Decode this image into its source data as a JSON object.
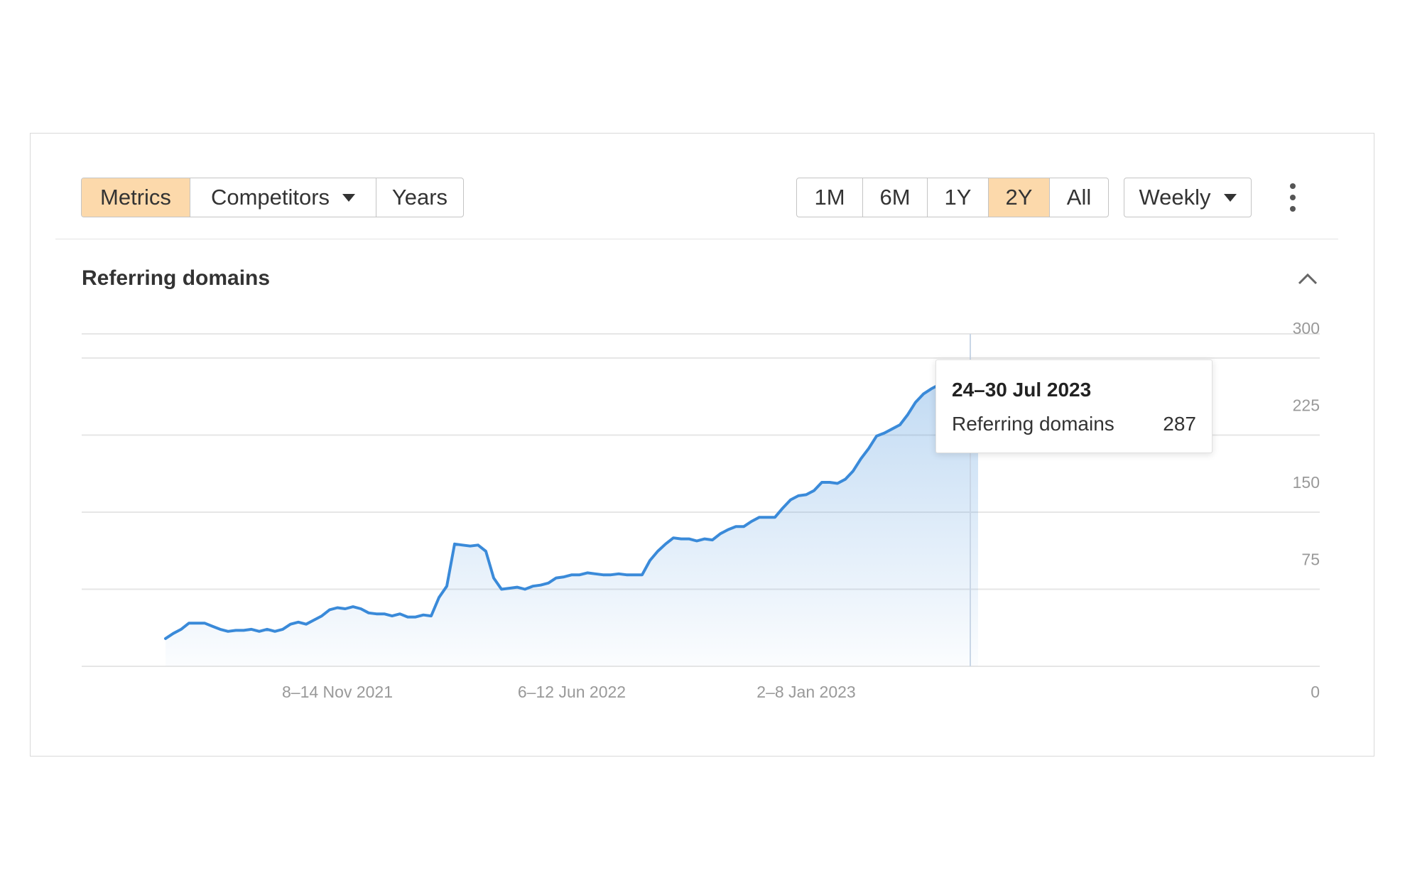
{
  "toolbar": {
    "view_tabs": [
      {
        "label": "Metrics",
        "active": true
      },
      {
        "label": "Competitors",
        "active": false,
        "dropdown": true
      },
      {
        "label": "Years",
        "active": false
      }
    ],
    "ranges": [
      {
        "label": "1M",
        "active": false
      },
      {
        "label": "6M",
        "active": false
      },
      {
        "label": "1Y",
        "active": false
      },
      {
        "label": "2Y",
        "active": true
      },
      {
        "label": "All",
        "active": false
      }
    ],
    "interval": "Weekly"
  },
  "section": {
    "title": "Referring domains"
  },
  "tooltip": {
    "date": "24–30 Jul 2023",
    "label": "Referring domains",
    "value": "287"
  },
  "colors": {
    "line": "#3a8ad9",
    "active_tab": "#fcd9ab",
    "grid": "#e6e6e6"
  },
  "chart_data": {
    "type": "area",
    "title": "Referring domains",
    "x_labels": [
      "8–14 Nov 2021",
      "6–12 Jun 2022",
      "2–8 Jan 2023"
    ],
    "x_label_weeks": [
      22,
      52,
      82
    ],
    "y_ticks": [
      0,
      75,
      150,
      225,
      300
    ],
    "ylim": [
      0,
      300
    ],
    "grid": true,
    "highlight_index": 103,
    "series": [
      {
        "name": "Referring domains",
        "values": [
          27,
          32,
          36,
          42,
          42,
          42,
          39,
          36,
          34,
          35,
          35,
          36,
          34,
          36,
          34,
          36,
          41,
          43,
          41,
          45,
          49,
          55,
          57,
          56,
          58,
          56,
          52,
          51,
          51,
          49,
          51,
          48,
          48,
          50,
          49,
          67,
          78,
          119,
          118,
          117,
          118,
          112,
          86,
          75,
          76,
          77,
          75,
          78,
          79,
          81,
          86,
          87,
          89,
          89,
          91,
          90,
          89,
          89,
          90,
          89,
          89,
          89,
          103,
          112,
          119,
          125,
          124,
          124,
          122,
          124,
          123,
          129,
          133,
          136,
          136,
          141,
          145,
          145,
          145,
          154,
          162,
          166,
          167,
          171,
          179,
          179,
          178,
          182,
          190,
          202,
          212,
          224,
          227,
          231,
          235,
          245,
          257,
          265,
          270,
          274,
          276,
          280,
          283,
          287,
          284
        ]
      }
    ]
  }
}
